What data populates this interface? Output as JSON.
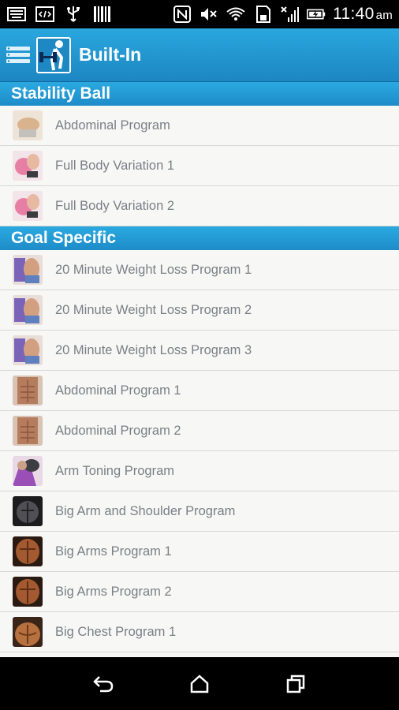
{
  "status_bar": {
    "time": "11:40",
    "ampm": "am",
    "left_icons": [
      "keyboard-icon",
      "code-icon",
      "usb-icon",
      "barcode-icon"
    ],
    "right_icons": [
      "nfc-icon",
      "mute-icon",
      "wifi-icon",
      "sd-card-icon",
      "signal-icon",
      "battery-charging-icon"
    ]
  },
  "action_bar": {
    "title": "Built-In"
  },
  "sections": [
    {
      "header": "Stability Ball",
      "items": [
        {
          "label": "Abdominal Program",
          "thumb": "beige"
        },
        {
          "label": "Full Body Variation 1",
          "thumb": "pink"
        },
        {
          "label": "Full Body Variation 2",
          "thumb": "pink"
        }
      ]
    },
    {
      "header": "Goal Specific",
      "items": [
        {
          "label": "20 Minute Weight Loss Program 1",
          "thumb": "multi"
        },
        {
          "label": "20 Minute Weight Loss Program 2",
          "thumb": "multi"
        },
        {
          "label": "20 Minute Weight Loss Program 3",
          "thumb": "multi"
        },
        {
          "label": "Abdominal Program 1",
          "thumb": "torso"
        },
        {
          "label": "Abdominal Program 2",
          "thumb": "torso"
        },
        {
          "label": "Arm Toning Program",
          "thumb": "purple"
        },
        {
          "label": "Big Arm and Shoulder Program",
          "thumb": "dark"
        },
        {
          "label": "Big Arms Program 1",
          "thumb": "bronze"
        },
        {
          "label": "Big Arms Program 2",
          "thumb": "bronze"
        },
        {
          "label": "Big Chest Program 1",
          "thumb": "chest"
        }
      ]
    }
  ],
  "colors": {
    "action_bar": "#1f90cc",
    "section_header": "#2399d4",
    "row_bg": "#f7f7f5",
    "row_text": "#7a7f85"
  }
}
